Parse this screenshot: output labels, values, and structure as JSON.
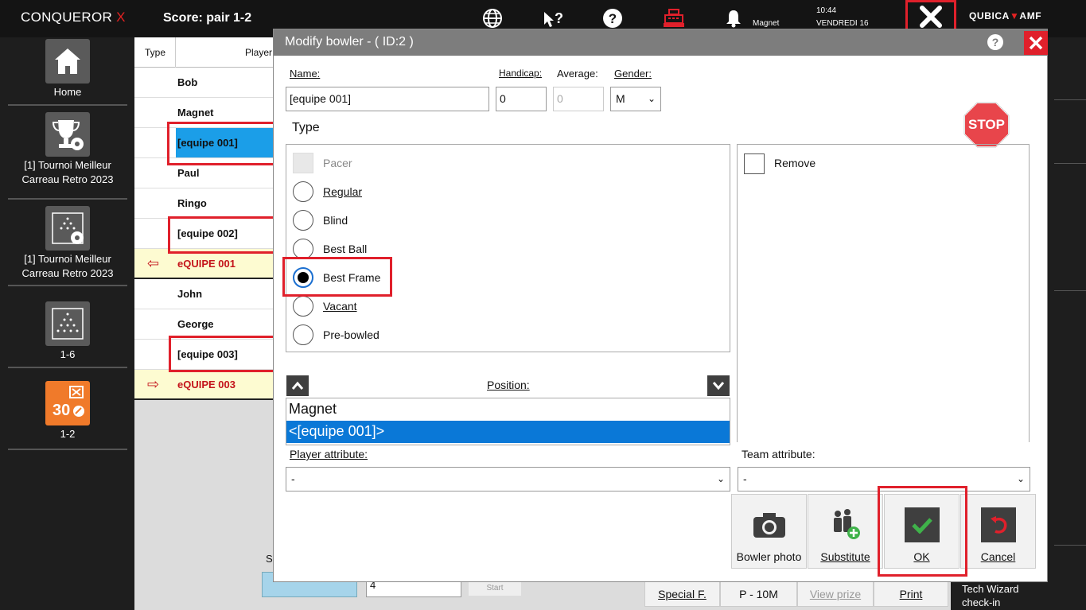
{
  "topbar": {
    "brand": "CONQUEROR",
    "brand_x": "X",
    "score": "Score: pair 1-2",
    "user_label": "Magnet",
    "time": "10:44",
    "date": "VENDREDI 16",
    "logo_left": "QUBICA",
    "logo_mark": "▼",
    "logo_right": "AMF"
  },
  "sidebar": {
    "items": [
      {
        "label": "Home",
        "icon": "home-icon"
      },
      {
        "label": "[1] Tournoi Meilleur Carreau Retro 2023",
        "icon": "trophy-gear-icon"
      },
      {
        "label": "[1] Tournoi Meilleur Carreau Retro 2023",
        "icon": "pins-gear-icon"
      },
      {
        "label": "1-6",
        "icon": "pins-icon"
      },
      {
        "label": "1-2",
        "icon": "score-30-icon"
      }
    ]
  },
  "table": {
    "col_type": "Type",
    "col_player": "Player",
    "rows": [
      {
        "name": "Bob",
        "kind": "player"
      },
      {
        "name": "Magnet",
        "kind": "player"
      },
      {
        "name": "[equipe 001]",
        "kind": "selected"
      },
      {
        "name": "Paul",
        "kind": "player"
      },
      {
        "name": "Ringo",
        "kind": "player"
      },
      {
        "name": "[equipe 002]",
        "kind": "player"
      },
      {
        "name": "eQUIPE 001",
        "kind": "team",
        "arrow": "⇦"
      },
      {
        "name": "John",
        "kind": "player"
      },
      {
        "name": "George",
        "kind": "player"
      },
      {
        "name": "[equipe 003]",
        "kind": "player"
      },
      {
        "name": "eQUIPE 003",
        "kind": "team",
        "arrow": "⇨"
      }
    ]
  },
  "bottom": {
    "s_label": "S",
    "input_value": "4",
    "start": "Start",
    "special": "Special F.",
    "p10m": "P - 10M",
    "view_prize": "View prize",
    "print": "Print",
    "tech_wizard": "Tech Wizard check-in"
  },
  "modal": {
    "title": "Modify bowler - ( ID:2 )",
    "name_label": "Name:",
    "name_value": "[equipe 001]",
    "handicap_label": "Handicap:",
    "handicap_value": "0",
    "average_label": "Average:",
    "average_value": "0",
    "gender_label": "Gender:",
    "gender_value": "M",
    "type_title": "Type",
    "types": [
      {
        "label": "Pacer",
        "kind": "pacer"
      },
      {
        "label": "Regular",
        "kind": "radio"
      },
      {
        "label": "Blind",
        "kind": "radio"
      },
      {
        "label": "Best Ball",
        "kind": "radio"
      },
      {
        "label": "Best Frame",
        "kind": "radio",
        "checked": true
      },
      {
        "label": "Vacant",
        "kind": "radio"
      },
      {
        "label": "Pre-bowled",
        "kind": "radio"
      }
    ],
    "stop": "STOP",
    "remove_label": "Remove",
    "position_label": "Position:",
    "positions": [
      "Magnet",
      "<[equipe 001]>"
    ],
    "player_attr_label": "Player attribute:",
    "player_attr_value": "-",
    "team_attr_label": "Team attribute:",
    "team_attr_value": "-",
    "actions": {
      "photo": "Bowler photo",
      "substitute": "Substitute",
      "ok": "OK",
      "cancel": "Cancel"
    },
    "help": "?"
  },
  "colors": {
    "accent_red": "#e0202b",
    "selected_blue": "#1b9ee8",
    "list_blue": "#0a78d7",
    "ok_green": "#3fb24a",
    "sidebar_orange": "#f07a2a"
  }
}
